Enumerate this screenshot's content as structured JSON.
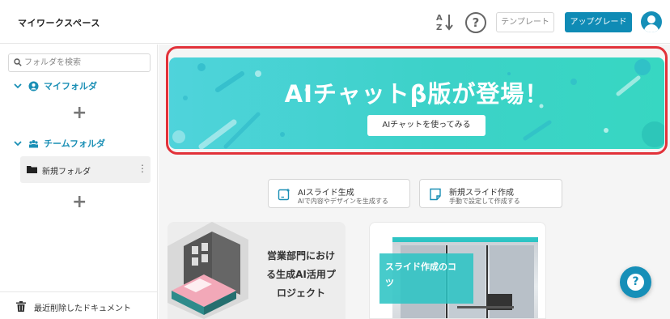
{
  "header": {
    "title": "マイワークスペース",
    "sort_icon": "sort-alpha-icon",
    "help_icon_glyph": "?",
    "template_label": "テンプレート",
    "upgrade_label": "アップグレード"
  },
  "sidebar": {
    "search_placeholder": "フォルダを検索",
    "my_folder_label": "マイフォルダ",
    "team_folder_label": "チームフォルダ",
    "add_glyph": "+",
    "new_folder_label": "新規フォルダ",
    "kebab_glyph": "⋮",
    "recent_deleted_label": "最近削除したドキュメント"
  },
  "banner": {
    "title": "AIチャットβ版が登場！",
    "button_label": "AIチャットを使ってみる"
  },
  "actions": [
    {
      "title": "AIスライド生成",
      "subtitle": "AIで内容やデザインを生成する"
    },
    {
      "title": "新規スライド作成",
      "subtitle": "手動で設定して作成する"
    }
  ],
  "templates": [
    {
      "line1": "営業部門におけ",
      "line2": "る生成AI活用プ",
      "line3": "ロジェクト"
    },
    {
      "line1": "スライド作成のコ",
      "line2": "ツ"
    }
  ],
  "help_fab_glyph": "?",
  "colors": {
    "accent": "#1a8fb5",
    "banner": "#3cd2c8",
    "highlight": "#e2323a"
  }
}
